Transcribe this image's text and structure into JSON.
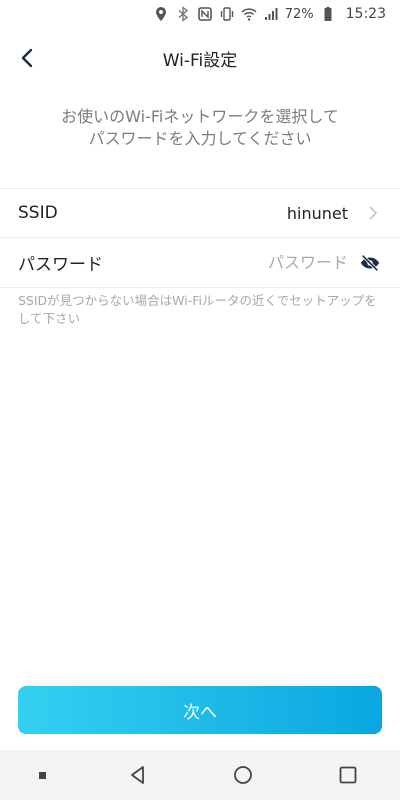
{
  "status_bar": {
    "icons": [
      "location-icon",
      "bluetooth-icon",
      "nfc-icon",
      "vibrate-icon",
      "wifi-icon",
      "signal-icon",
      "battery-icon"
    ],
    "battery": "72%",
    "time": "15:23"
  },
  "header": {
    "title": "Wi-Fi設定",
    "back_icon": "chevron-left-icon"
  },
  "instruction": {
    "line1": "お使いのWi-Fiネットワークを選択して",
    "line2": "パスワードを入力してください"
  },
  "form": {
    "ssid": {
      "label": "SSID",
      "value": "hinunet",
      "icon": "chevron-right-icon"
    },
    "password": {
      "label": "パスワード",
      "value": "",
      "placeholder": "パスワード",
      "icon": "eye-off-icon"
    }
  },
  "hint": "SSIDが見つからない場合はWi-Fiルータの近くでセットアップをして下さい",
  "next_button": {
    "label": "次へ"
  },
  "nav_bar": {
    "icons": [
      "recents-dot-icon",
      "back-triangle-icon",
      "home-circle-icon",
      "overview-square-icon"
    ]
  },
  "colors": {
    "accent_start": "#33d1f0",
    "accent_end": "#0aa6e2",
    "instruction_text": "#7d7d7d",
    "hint_text": "#a8a8a8"
  }
}
